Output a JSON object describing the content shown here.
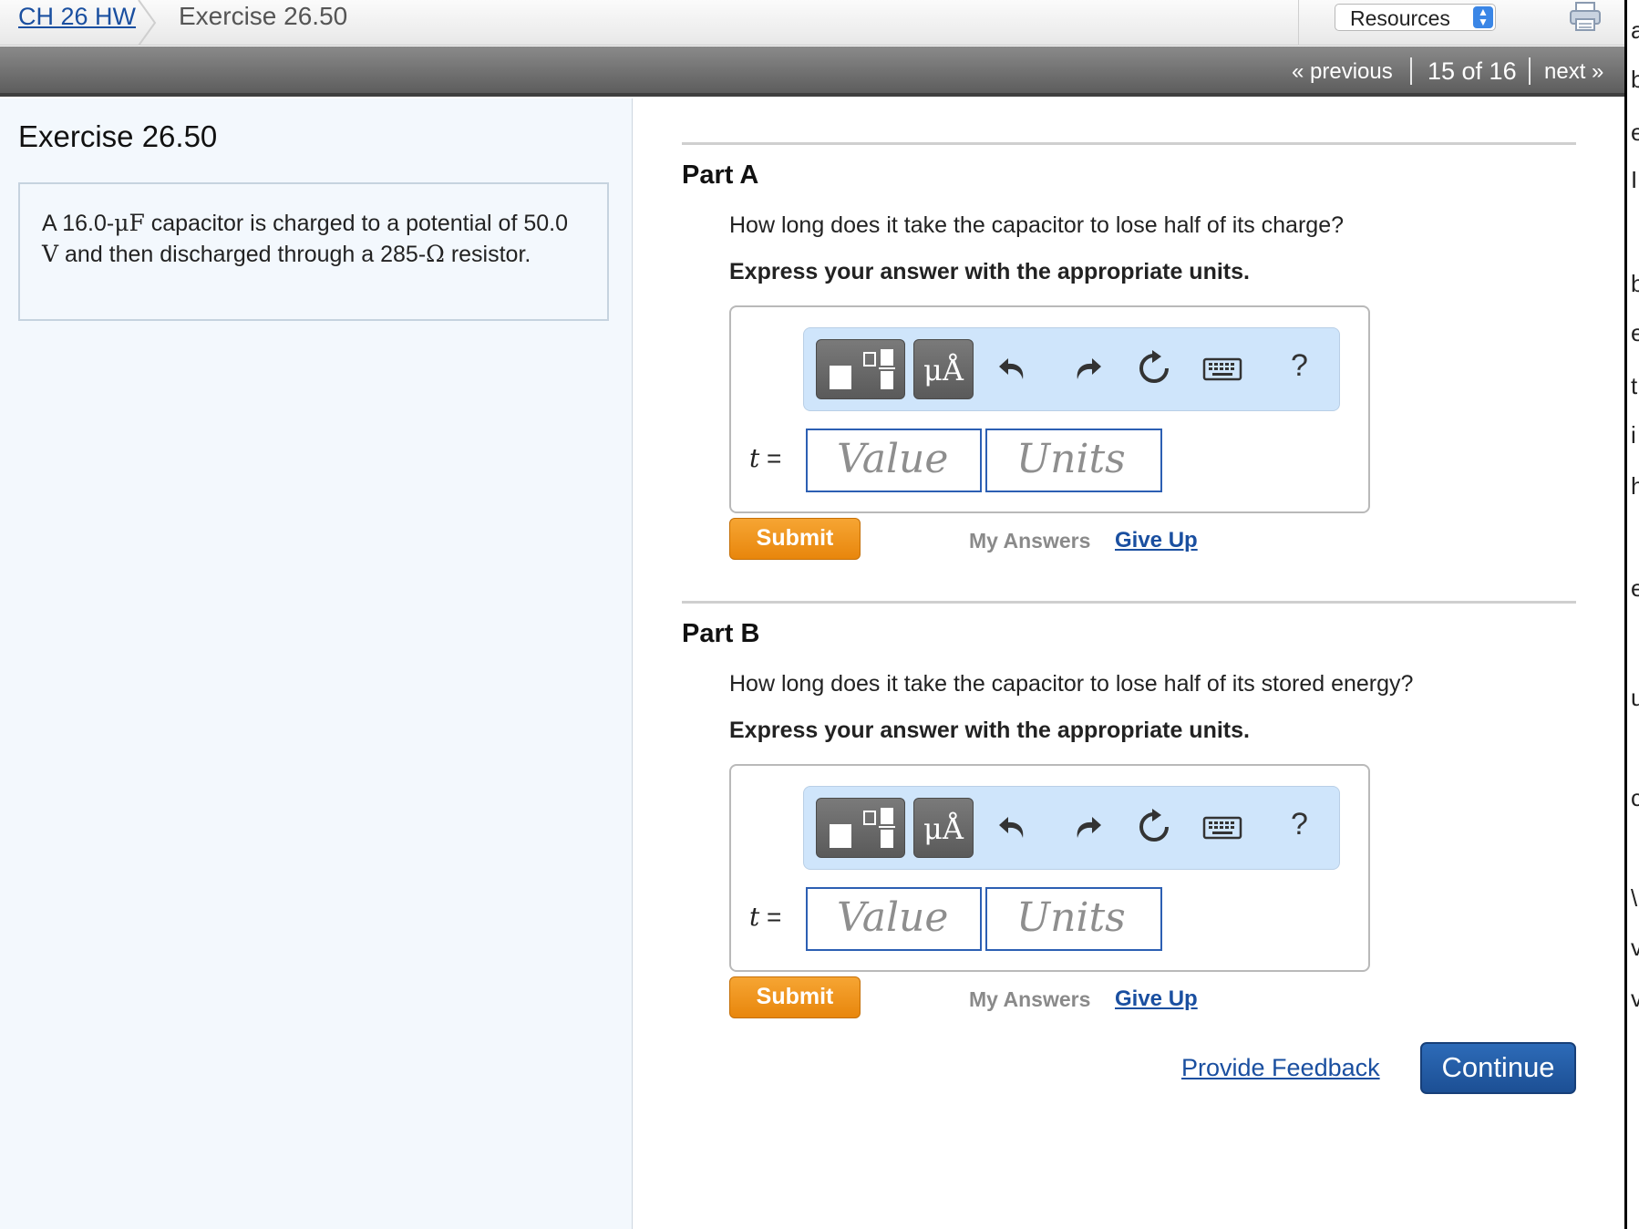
{
  "header": {
    "breadcrumb_link": "CH 26 HW",
    "breadcrumb_current": "Exercise 26.50",
    "resources_label": "Resources",
    "print_icon": "printer-icon"
  },
  "navigation": {
    "previous": "« previous",
    "position": "15 of 16",
    "next": "next »"
  },
  "edge_letters": [
    "a",
    "b",
    "e",
    "I",
    "b",
    "e",
    "t",
    "i",
    "h",
    "e",
    "u",
    "c",
    "\\",
    "v",
    "v"
  ],
  "left_panel": {
    "title": "Exercise 26.50",
    "problem": {
      "t1": "A 16.0-",
      "unit_capacitance": "μF",
      "t2": " capacitor is charged to a potential of 50.0 ",
      "unit_voltage": "V",
      "t3": " and then discharged through a 285-",
      "unit_resistance": "Ω",
      "t4": " resistor."
    }
  },
  "parts": [
    {
      "title": "Part A",
      "question": "How long does it take the capacitor to lose half of its charge?",
      "instruction": "Express your answer with the appropriate units.",
      "variable": "t",
      "equals": "=",
      "value_placeholder": "Value",
      "units_placeholder": "Units",
      "submit_label": "Submit",
      "my_answers_label": "My Answers",
      "give_up_label": "Give Up"
    },
    {
      "title": "Part B",
      "question": "How long does it take the capacitor to lose half of its stored energy?",
      "instruction": "Express your answer with the appropriate units.",
      "variable": "t",
      "equals": "=",
      "value_placeholder": "Value",
      "units_placeholder": "Units",
      "submit_label": "Submit",
      "my_answers_label": "My Answers",
      "give_up_label": "Give Up"
    }
  ],
  "toolbar": {
    "units_button": "μÅ",
    "help": "?",
    "icons": [
      "templates-icon",
      "units-icon",
      "undo-icon",
      "redo-icon",
      "reset-icon",
      "keyboard-icon",
      "help-icon"
    ]
  },
  "footer": {
    "feedback_label": "Provide Feedback",
    "continue_label": "Continue"
  },
  "colors": {
    "link": "#1a4fa0",
    "submit": "#e8860c",
    "continue": "#1c4f94",
    "left_panel_bg": "#f3f8fd",
    "toolbar_bg": "#cfe5fb",
    "input_border": "#2c5fb3"
  }
}
